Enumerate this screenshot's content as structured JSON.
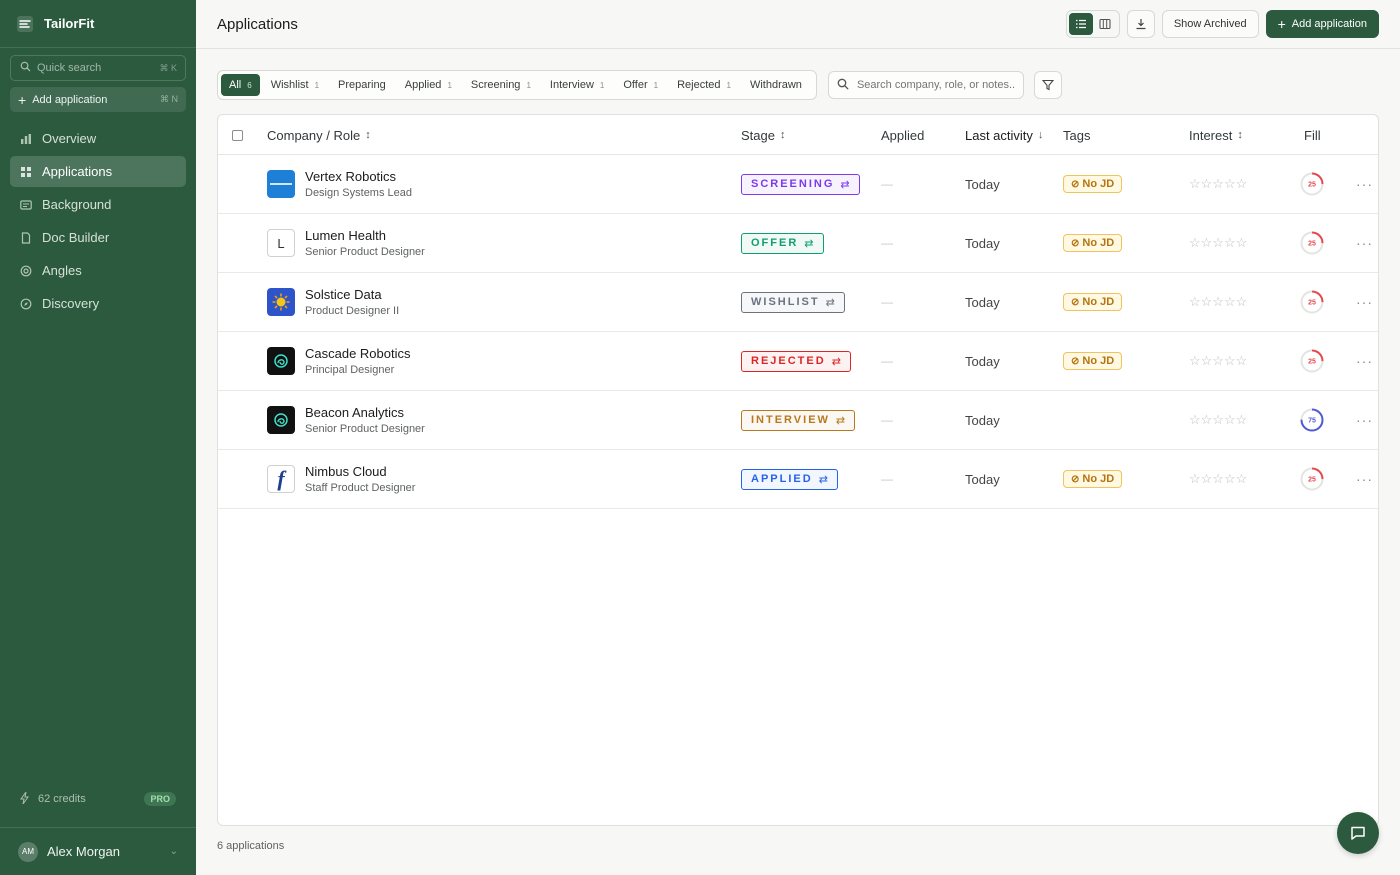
{
  "app": {
    "name": "TailorFit",
    "page_title": "Applications"
  },
  "sidebar": {
    "quick_search_placeholder": "Quick search",
    "quick_search_shortcut": "⌘ K",
    "add_application_label": "Add application",
    "add_application_shortcut": "⌘ N",
    "nav": [
      {
        "label": "Overview",
        "icon": "bar-chart-icon"
      },
      {
        "label": "Applications",
        "icon": "grid-icon",
        "active": true
      },
      {
        "label": "Background",
        "icon": "id-card-icon"
      },
      {
        "label": "Doc Builder",
        "icon": "document-icon"
      },
      {
        "label": "Angles",
        "icon": "target-icon"
      },
      {
        "label": "Discovery",
        "icon": "compass-icon"
      }
    ],
    "credits": "62 credits",
    "plan_badge": "PRO",
    "user": {
      "initials": "AM",
      "name": "Alex Morgan"
    }
  },
  "toolbar": {
    "show_archived_label": "Show Archived",
    "add_application_label": "Add application"
  },
  "filters": {
    "tabs": [
      {
        "label": "All",
        "count": "6",
        "active": true
      },
      {
        "label": "Wishlist",
        "count": "1"
      },
      {
        "label": "Preparing",
        "count": ""
      },
      {
        "label": "Applied",
        "count": "1"
      },
      {
        "label": "Screening",
        "count": "1"
      },
      {
        "label": "Interview",
        "count": "1"
      },
      {
        "label": "Offer",
        "count": "1"
      },
      {
        "label": "Rejected",
        "count": "1"
      },
      {
        "label": "Withdrawn",
        "count": ""
      }
    ],
    "search_placeholder": "Search company, role, or notes..."
  },
  "table": {
    "columns": {
      "company_role": "Company / Role",
      "stage": "Stage",
      "applied": "Applied",
      "last_activity": "Last activity",
      "tags": "Tags",
      "interest": "Interest",
      "fill": "Fill"
    },
    "rows": [
      {
        "company": "Vertex Robotics",
        "role": "Design Systems Lead",
        "stage": "SCREENING",
        "applied": "—",
        "last_activity": "Today",
        "tag": "No JD",
        "stars": "☆☆☆☆☆",
        "fill": 25,
        "logo": "vertex"
      },
      {
        "company": "Lumen Health",
        "role": "Senior Product Designer",
        "stage": "OFFER",
        "applied": "—",
        "last_activity": "Today",
        "tag": "No JD",
        "stars": "☆☆☆☆☆",
        "fill": 25,
        "logo": "lumen",
        "logo_letter": "L"
      },
      {
        "company": "Solstice Data",
        "role": "Product Designer II",
        "stage": "WISHLIST",
        "applied": "—",
        "last_activity": "Today",
        "tag": "No JD",
        "stars": "☆☆☆☆☆",
        "fill": 25,
        "logo": "solstice"
      },
      {
        "company": "Cascade Robotics",
        "role": "Principal Designer",
        "stage": "REJECTED",
        "applied": "—",
        "last_activity": "Today",
        "tag": "No JD",
        "stars": "☆☆☆☆☆",
        "fill": 25,
        "logo": "swirl"
      },
      {
        "company": "Beacon Analytics",
        "role": "Senior Product Designer",
        "stage": "INTERVIEW",
        "applied": "—",
        "last_activity": "Today",
        "tag": "",
        "stars": "☆☆☆☆☆",
        "fill": 75,
        "logo": "swirl"
      },
      {
        "company": "Nimbus Cloud",
        "role": "Staff Product Designer",
        "stage": "APPLIED",
        "applied": "—",
        "last_activity": "Today",
        "tag": "No JD",
        "stars": "☆☆☆☆☆",
        "fill": 25,
        "logo": "nimbus",
        "logo_letter": "f"
      }
    ]
  },
  "stage_colors": {
    "SCREENING": "#7c3aed",
    "OFFER": "#0f9f6e",
    "WISHLIST": "#6b7280",
    "REJECTED": "#dc2626",
    "INTERVIEW": "#b7791f",
    "APPLIED": "#2563eb"
  },
  "fill_colors": {
    "low": "#e5484d",
    "high": "#4f5bd5"
  },
  "footer": {
    "count_text": "6 applications"
  }
}
